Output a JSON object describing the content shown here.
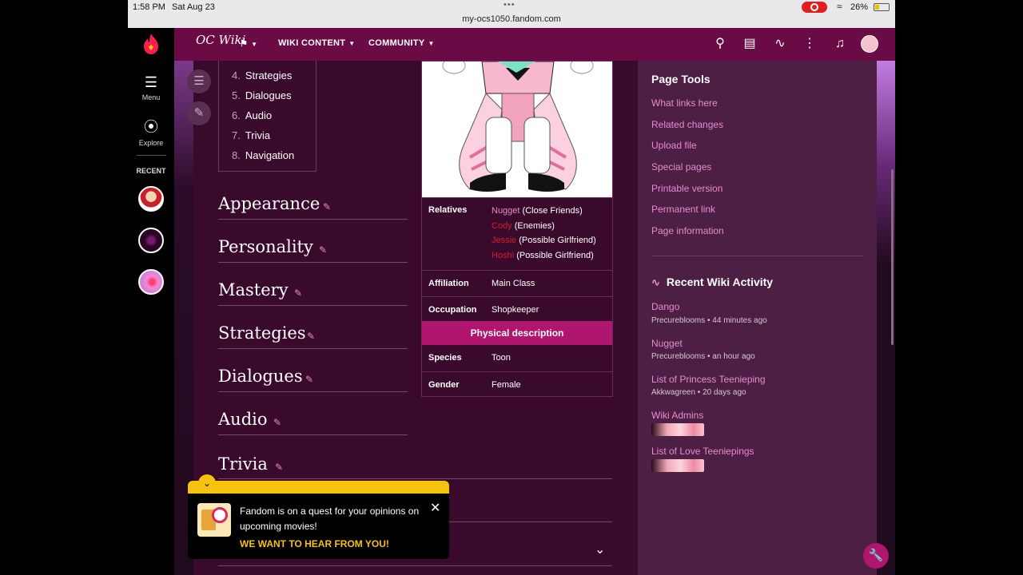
{
  "status_bar": {
    "time": "1:58 PM",
    "date": "Sat Aug 23",
    "url": "my-ocs1050.fandom.com",
    "battery": "26%"
  },
  "global_nav": {
    "menu_label": "Menu",
    "explore_label": "Explore",
    "recent_label": "RECENT"
  },
  "wiki_header": {
    "logo_text": "OC Wiki",
    "nav": [
      "WIKI CONTENT",
      "COMMUNITY"
    ]
  },
  "toc": {
    "items": [
      {
        "num": "4.",
        "label": "Strategies"
      },
      {
        "num": "5.",
        "label": "Dialogues"
      },
      {
        "num": "6.",
        "label": "Audio"
      },
      {
        "num": "7.",
        "label": "Trivia"
      },
      {
        "num": "8.",
        "label": "Navigation"
      }
    ]
  },
  "sections": [
    "Appearance",
    "Personality",
    "Mastery",
    "Strategies",
    "Dialogues",
    "Audio",
    "Trivia"
  ],
  "infobox": {
    "relatives_label": "Relatives",
    "relatives": [
      {
        "name": "Nugget",
        "note": "(Close Friends)",
        "type": "link"
      },
      {
        "name": "Cody",
        "note": "(Enemies)",
        "type": "redlink"
      },
      {
        "name": "Jessie",
        "note": "(Possible Girlfriend)",
        "type": "redlink"
      },
      {
        "name": "Hoshi",
        "note": "(Possible Girlfriend)",
        "type": "redlink"
      }
    ],
    "affiliation_label": "Affiliation",
    "affiliation": "Main Class",
    "occupation_label": "Occupation",
    "occupation": "Shopkeeper",
    "physical_header": "Physical description",
    "species_label": "Species",
    "species": "Toon",
    "gender_label": "Gender",
    "gender": "Female"
  },
  "page_tools": {
    "title": "Page Tools",
    "links": [
      "What links here",
      "Related changes",
      "Upload file",
      "Special pages",
      "Printable version",
      "Permanent link",
      "Page information"
    ]
  },
  "recent_activity": {
    "title": "Recent Wiki Activity",
    "items": [
      {
        "title": "Dango",
        "meta": "Precureblooms • 44 minutes ago"
      },
      {
        "title": "Nugget",
        "meta": "Precureblooms • an hour ago"
      },
      {
        "title": "List of Princess Teenieping",
        "meta": "Akkwagreen • 20 days ago"
      },
      {
        "title": "Wiki Admins",
        "meta": ""
      },
      {
        "title": "List of Love Teeniepings",
        "meta": ""
      }
    ]
  },
  "popup": {
    "message": "Fandom is on a quest for your opinions on upcoming movies!",
    "cta": "WE WANT TO HEAR FROM YOU!"
  },
  "colors": {
    "header": "#6b0b45",
    "accent": "#b0156f",
    "link": "#e88bd2",
    "redlink": "#d61b2c",
    "popup_accent": "#f6c20d"
  }
}
